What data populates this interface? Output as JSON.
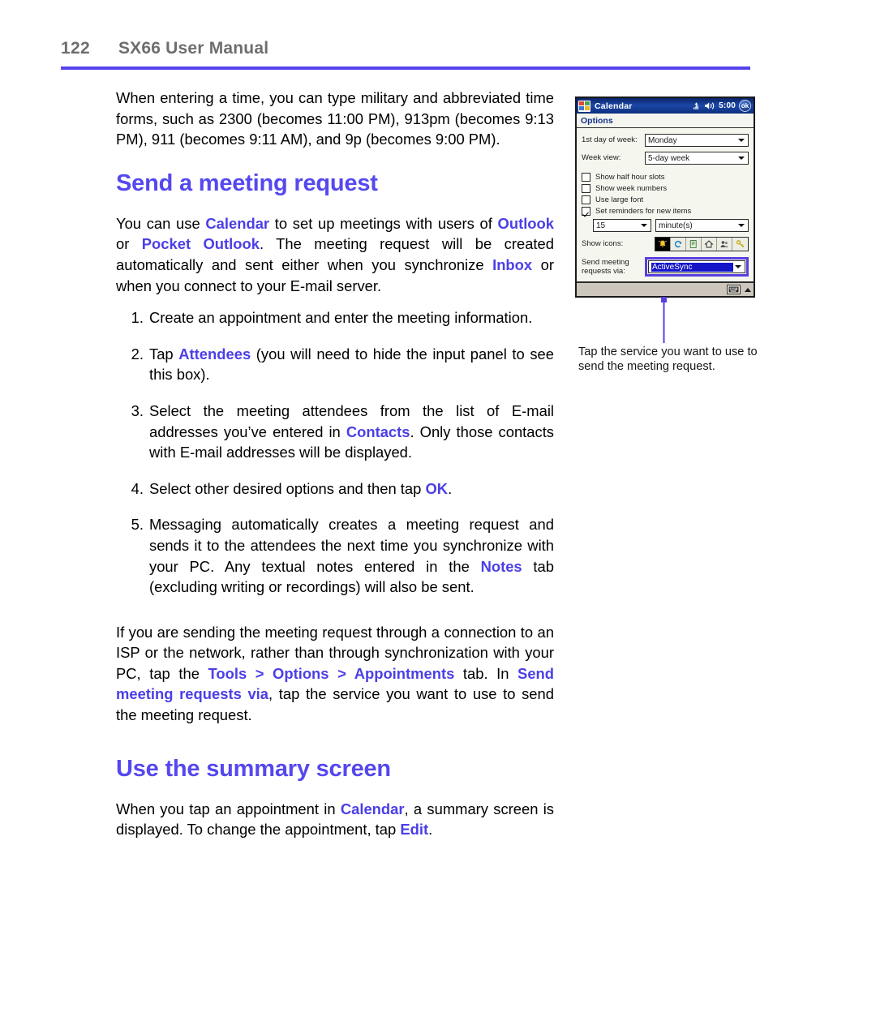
{
  "header": {
    "page_number": "122",
    "manual_title": "SX66 User Manual",
    "rule_color": "#5544ee"
  },
  "body": {
    "intro_paragraph": "When entering a time, you can type military and abbreviated time forms, such as 2300 (becomes 11:00 PM), 913pm (becomes 9:13 PM), 911 (becomes 9:11 AM), and 9p (becomes 9:00 PM).",
    "section1_heading": "Send a meeting request",
    "section1_intro": {
      "t1": "You can use ",
      "h1": "Calendar",
      "t2": " to set up meetings with users of ",
      "h2": "Outlook",
      "t3": " or ",
      "h3": "Pocket Outlook",
      "t4": ". The meeting request will be created automatically and sent either when you synchronize ",
      "h4": "Inbox",
      "t5": " or when you connect to your E-mail server."
    },
    "steps": [
      {
        "num": "1.",
        "t1": "Create an appointment and enter the meeting information.",
        "h1": "",
        "t2": ""
      },
      {
        "num": "2.",
        "t1": "Tap ",
        "h1": "Attendees",
        "t2": " (you will need to hide the input panel to see this box)."
      },
      {
        "num": "3.",
        "t1": "Select the meeting attendees from the list of E-mail addresses you’ve entered in ",
        "h1": "Contacts",
        "t2": ". Only those contacts with E-mail addresses will be displayed."
      },
      {
        "num": "4.",
        "t1": "Select other desired options and then tap ",
        "h1": "OK",
        "t2": "."
      },
      {
        "num": "5.",
        "t1": "Messaging automatically creates a meeting request and sends it to the attendees the next time you synchronize with your PC. Any textual notes entered in the ",
        "h1": "Notes",
        "t2": " tab (excluding writing or recordings) will also be sent."
      }
    ],
    "isp_paragraph": {
      "t1": "If you are sending the meeting request through a connection to an ISP or the network, rather than through synchronization with your PC, tap the ",
      "h1": "Tools > Options > Appointments",
      "t2": " tab. In ",
      "h2": "Send meeting requests via",
      "t3": ", tap the service you want to use to send the meeting request."
    },
    "section2_heading": "Use the summary screen",
    "section2_para": {
      "t1": "When you tap an appointment in ",
      "h1": "Calendar",
      "t2": ", a summary screen is displayed. To change the appointment, tap ",
      "h2": "Edit",
      "t3": "."
    }
  },
  "figure": {
    "caption": "Tap the service you want to use to send the meeting request.",
    "callout_color": "#5a3fe0",
    "pda": {
      "titlebar": {
        "app_title": "Calendar",
        "time": "5:00",
        "ok_label": "ok",
        "signal_icon": "signal-icon",
        "speaker_icon": "speaker-icon",
        "start_icon": "windows-flag-icon"
      },
      "menubar_label": "Options",
      "fields": [
        {
          "label": "1st day of week:",
          "value": "Monday"
        },
        {
          "label": "Week view:",
          "value": "5-day week"
        }
      ],
      "checkboxes": [
        {
          "label": "Show half hour slots",
          "checked": false
        },
        {
          "label": "Show week numbers",
          "checked": false
        },
        {
          "label": "Use large font",
          "checked": false
        },
        {
          "label": "Set reminders for new items",
          "checked": true
        }
      ],
      "reminder": {
        "amount": "15",
        "unit": "minute(s)"
      },
      "show_icons_label": "Show icons:",
      "show_icons": [
        {
          "name": "reminder-bell-icon",
          "selected": true
        },
        {
          "name": "recurrence-icon",
          "selected": false
        },
        {
          "name": "note-icon",
          "selected": false
        },
        {
          "name": "location-home-icon",
          "selected": false
        },
        {
          "name": "attendees-icon",
          "selected": false
        },
        {
          "name": "private-key-icon",
          "selected": false
        }
      ],
      "send_meeting_label_line1": "Send meeting",
      "send_meeting_label_line2": "requests via:",
      "send_meeting_value": "ActiveSync",
      "taskbar": {
        "keyboard_icon": "input-panel-keyboard-icon",
        "arrow_icon": "chevron-up-icon"
      }
    }
  }
}
